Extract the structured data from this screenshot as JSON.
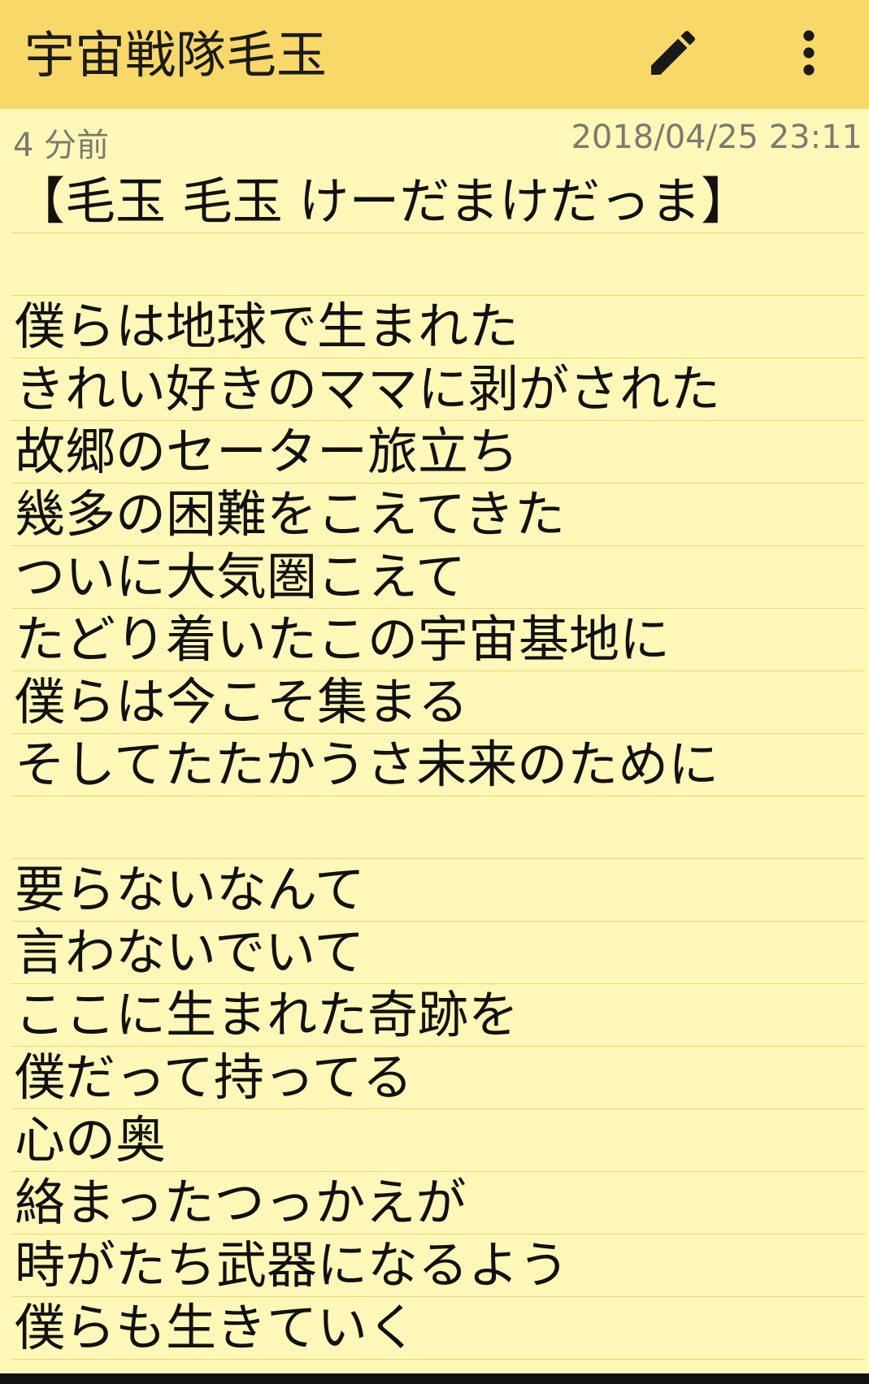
{
  "appbar": {
    "title": "宇宙戦隊毛玉",
    "edit_icon": "pencil-icon",
    "more_icon": "more-vert-icon"
  },
  "meta": {
    "relative_time": "4 分前",
    "datetime": "2018/04/25 23:11"
  },
  "note": {
    "lines": [
      "【毛玉 毛玉 けーだまけだっま】",
      "",
      "僕らは地球で生まれた",
      "きれい好きのママに剥がされた",
      "故郷のセーター旅立ち",
      "幾多の困難をこえてきた",
      "ついに大気圏こえて",
      "たどり着いたこの宇宙基地に",
      "僕らは今こそ集まる",
      "そしてたたかうさ未来のために",
      "",
      "要らないなんて",
      "言わないでいて",
      "ここに生まれた奇跡を",
      "僕だって持ってる",
      "心の奥",
      "絡まったつっかえが",
      "時がたち武器になるよう",
      "僕らも生きていく"
    ]
  },
  "colors": {
    "appbar": "#f7d868",
    "paper": "#fff8b8",
    "rule": "#ead968",
    "meta_text": "#7a7a6e"
  }
}
